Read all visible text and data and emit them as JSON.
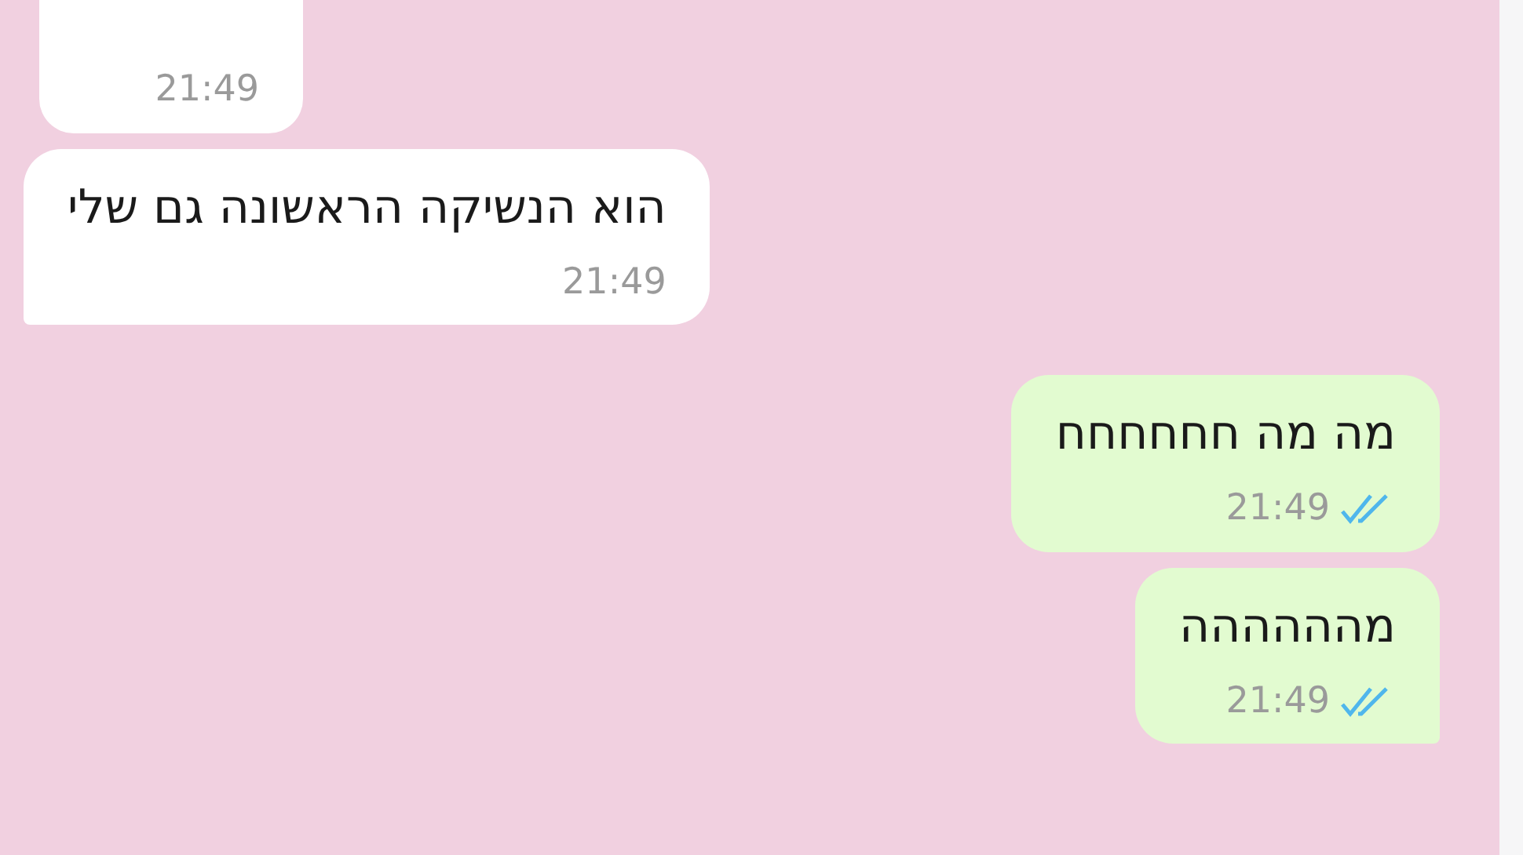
{
  "messages": [
    {
      "kind": "in",
      "cut": true,
      "time": "21:49"
    },
    {
      "kind": "in",
      "cut": false,
      "text": "הוא הנשיקה הראשונה גם שלי",
      "time": "21:49"
    },
    {
      "kind": "out",
      "cut": false,
      "text": "מה מה חחחחחח",
      "time": "21:49",
      "read": true
    },
    {
      "kind": "out",
      "cut": false,
      "text": "מהההההה",
      "time": "21:49",
      "read": true
    }
  ]
}
